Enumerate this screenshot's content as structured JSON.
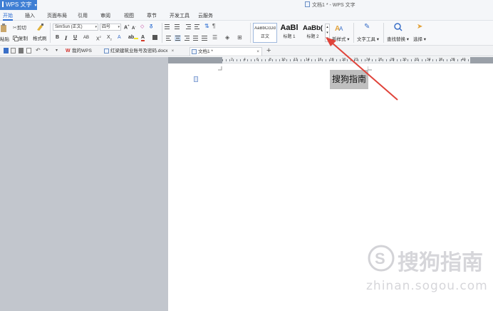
{
  "app": {
    "name": "WPS 文字",
    "window_title": "文档1 * - WPS 文字"
  },
  "menu": {
    "tabs": [
      {
        "label": "开始",
        "active": true
      },
      {
        "label": "插入"
      },
      {
        "label": "页面布局"
      },
      {
        "label": "引用"
      },
      {
        "label": "审阅"
      },
      {
        "label": "视图"
      },
      {
        "label": "章节"
      },
      {
        "label": "开发工具"
      },
      {
        "label": "云服务"
      }
    ]
  },
  "ribbon": {
    "paste": "粘贴",
    "cut": "剪切",
    "copy": "复制",
    "format_painter": "格式刷",
    "font_name": "SimSun (正文)",
    "font_size": "四号",
    "styles": [
      {
        "sample": "AaBbCcDd",
        "label": "正文"
      },
      {
        "sample": "AaBl",
        "label": "标题 1"
      },
      {
        "sample": "AaBb(",
        "label": "标题 2"
      }
    ],
    "new_style": "新样式",
    "text_tools": "文字工具",
    "find_replace": "查找替换",
    "select": "选择"
  },
  "doc_tabs": [
    {
      "label": "我的WPS",
      "active": false,
      "closable": false
    },
    {
      "label": "红梁建筑业账号及密码.docx",
      "active": false,
      "closable": true
    },
    {
      "label": "文档1 *",
      "active": true,
      "closable": true
    }
  ],
  "ruler": {
    "numbers": [
      "2",
      "4",
      "6",
      "8",
      "10",
      "12",
      "14",
      "16",
      "18",
      "20",
      "22",
      "24",
      "26",
      "28",
      "30",
      "32",
      "34",
      "36",
      "38",
      "40"
    ]
  },
  "document": {
    "selected_text": "搜狗指南"
  },
  "watermark": {
    "name": "搜狗指南",
    "url": "zhinan.sogou.com"
  },
  "colors": {
    "accent": "#2b6cd1",
    "app_button": "#3f7fd4",
    "arrow": "#e0433a",
    "selection": "#bfbfbf"
  }
}
